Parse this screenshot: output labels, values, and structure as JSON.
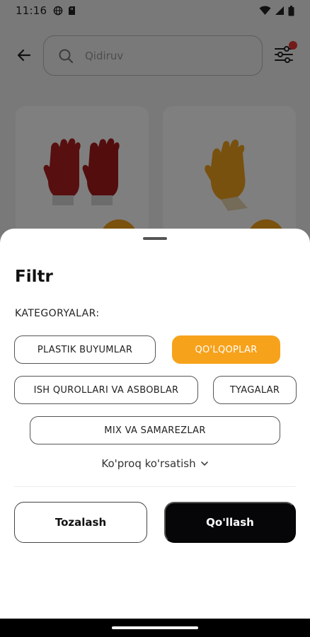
{
  "status_bar": {
    "time": "11:16"
  },
  "header": {
    "search_placeholder": "Qidiruv"
  },
  "colors": {
    "accent": "#f7a21b",
    "primary_button": "#060608",
    "notification_dot": "#e53935"
  },
  "filter_sheet": {
    "title": "Filtr",
    "categories_label": "KATEGORYALAR:",
    "categories": [
      {
        "label": "PLASTIK BUYUMLAR",
        "selected": false
      },
      {
        "label": "QO'LQOPLAR",
        "selected": true
      },
      {
        "label": "ISH QUROLLARI VA ASBOBLAR",
        "selected": false
      },
      {
        "label": "TYAGALAR",
        "selected": false
      },
      {
        "label": "MIX VA SAMAREZLAR",
        "selected": false
      }
    ],
    "show_more": "Ko'proq ko'rsatish",
    "clear_button": "Tozalash",
    "apply_button": "Qo'llash"
  },
  "icons": {
    "back": "arrow-left-icon",
    "search": "search-icon",
    "filter": "sliders-icon",
    "chevron": "chevron-down-icon"
  }
}
